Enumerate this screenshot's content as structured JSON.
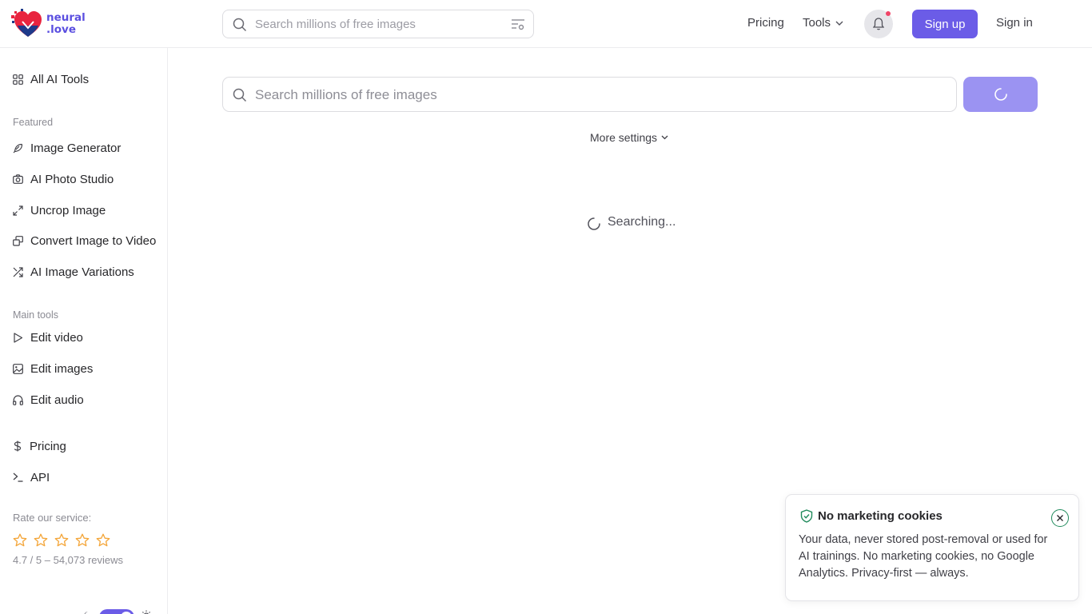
{
  "brand": {
    "line1": "neural",
    "line2": ".love"
  },
  "header": {
    "search_placeholder": "Search millions of free images",
    "pricing": "Pricing",
    "tools": "Tools",
    "signup": "Sign up",
    "signin": "Sign in"
  },
  "sidebar": {
    "all_tools": "All AI Tools",
    "featured_heading": "Featured",
    "featured": [
      "Image Generator",
      "AI Photo Studio",
      "Uncrop Image",
      "Convert Image to Video",
      "AI Image Variations"
    ],
    "main_heading": "Main tools",
    "main": [
      "Edit video",
      "Edit images",
      "Edit audio"
    ],
    "pricing": "Pricing",
    "api": "API",
    "rate_heading": "Rate our service:",
    "rating_text": "4.7 / 5 – 54,073 reviews",
    "star_color": "#f4a63a"
  },
  "main": {
    "search_placeholder": "Search millions of free images",
    "more_settings": "More settings",
    "status": "Searching..."
  },
  "toast": {
    "title": "No marketing cookies",
    "body": "Your data, never stored post-removal or used for AI trainings. No marketing cookies, no Google Analytics. Privacy-first — always."
  },
  "colors": {
    "accent": "#6b5ce7",
    "accent_light": "#9b93f2",
    "notification": "#f04467",
    "shield": "#1f8a5b"
  }
}
